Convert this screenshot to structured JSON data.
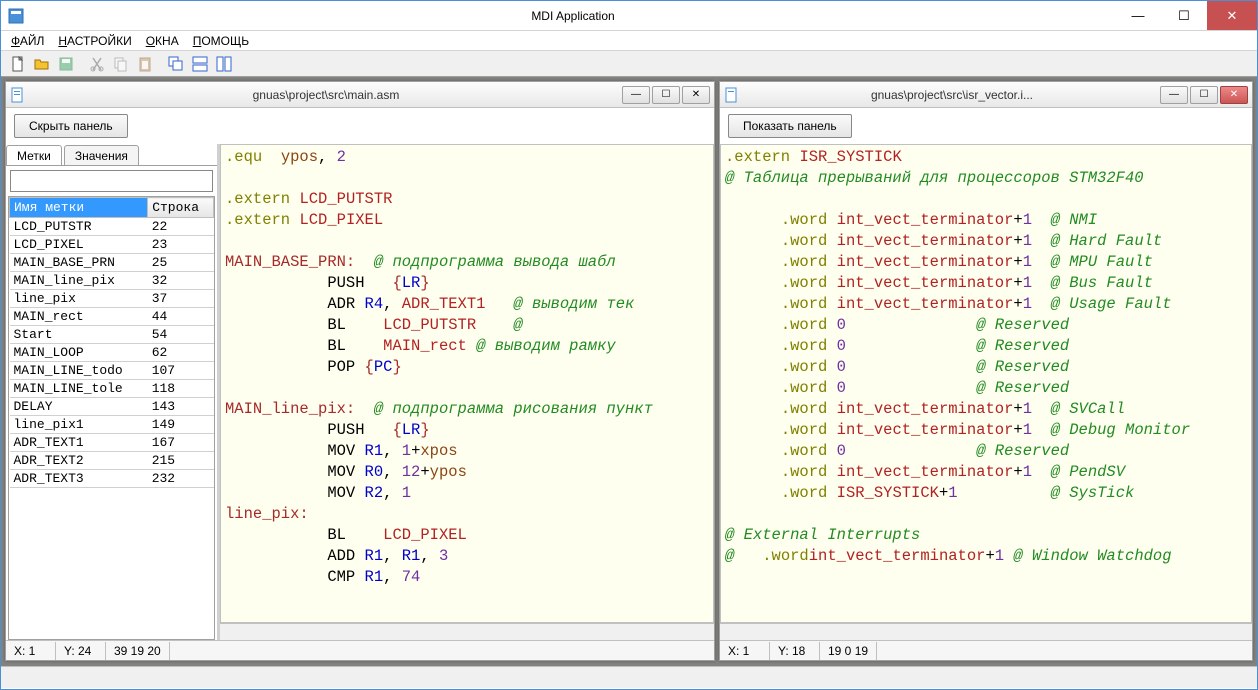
{
  "app": {
    "title": "MDI Application"
  },
  "menu": {
    "file": "ФАЙЛ",
    "settings": "НАСТРОЙКИ",
    "windows": "ОКНА",
    "help": "ПОМОЩЬ"
  },
  "mdi": {
    "left": {
      "title": "gnuas\\project\\src\\main.asm",
      "panel_button": "Скрыть панель",
      "tabs": {
        "labels": "Метки",
        "values": "Значения"
      },
      "table": {
        "col_name": "Имя метки",
        "col_line": "Строка",
        "rows": [
          {
            "name": "LCD_PUTSTR",
            "line": "22"
          },
          {
            "name": "LCD_PIXEL",
            "line": "23"
          },
          {
            "name": "MAIN_BASE_PRN",
            "line": "25"
          },
          {
            "name": "MAIN_line_pix",
            "line": "32"
          },
          {
            "name": "line_pix",
            "line": "37"
          },
          {
            "name": "MAIN_rect",
            "line": "44"
          },
          {
            "name": "Start",
            "line": "54"
          },
          {
            "name": "MAIN_LOOP",
            "line": "62"
          },
          {
            "name": "MAIN_LINE_todo",
            "line": "107"
          },
          {
            "name": "MAIN_LINE_tole",
            "line": "118"
          },
          {
            "name": "DELAY",
            "line": "143"
          },
          {
            "name": "line_pix1",
            "line": "149"
          },
          {
            "name": "ADR_TEXT1",
            "line": "167"
          },
          {
            "name": "ADR_TEXT2",
            "line": "215"
          },
          {
            "name": "ADR_TEXT3",
            "line": "232"
          }
        ]
      },
      "status": {
        "x": "X: 1",
        "y": "Y: 24",
        "extra": "39 19 20"
      }
    },
    "right": {
      "title": "gnuas\\project\\src\\isr_vector.i...",
      "panel_button": "Показать панель",
      "status": {
        "x": "X: 1",
        "y": "Y: 18",
        "extra": "19 0 19"
      }
    }
  },
  "colors": {
    "code_bg": "#fffff0",
    "accent": "#3399ff"
  },
  "chart_data": null
}
